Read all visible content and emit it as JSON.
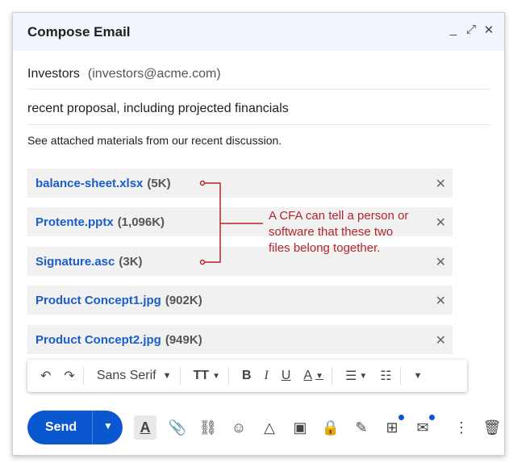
{
  "window": {
    "title": "Compose Email"
  },
  "to": {
    "name": "Investors",
    "email": "(investors@acme.com)"
  },
  "subject": "recent proposal, including projected financials",
  "body": "See attached materials from our recent discussion.",
  "attachments": [
    {
      "name": "balance-sheet.xlsx",
      "size": "(5K)"
    },
    {
      "name": "Protente.pptx",
      "size": "(1,096K)"
    },
    {
      "name": "Signature.asc",
      "size": "(3K)"
    },
    {
      "name": "Product Concept1.jpg",
      "size": "(902K)"
    },
    {
      "name": "Product Concept2.jpg",
      "size": "(949K)"
    }
  ],
  "annotation": {
    "lines": [
      "A CFA can tell a person or",
      "software that these two",
      "files belong together."
    ]
  },
  "format": {
    "font": "Sans Serif"
  },
  "send": {
    "label": "Send"
  },
  "colors": {
    "accent": "#0b57d0",
    "annotation": "#b3262e",
    "attachment_link": "#1a5ec9"
  }
}
